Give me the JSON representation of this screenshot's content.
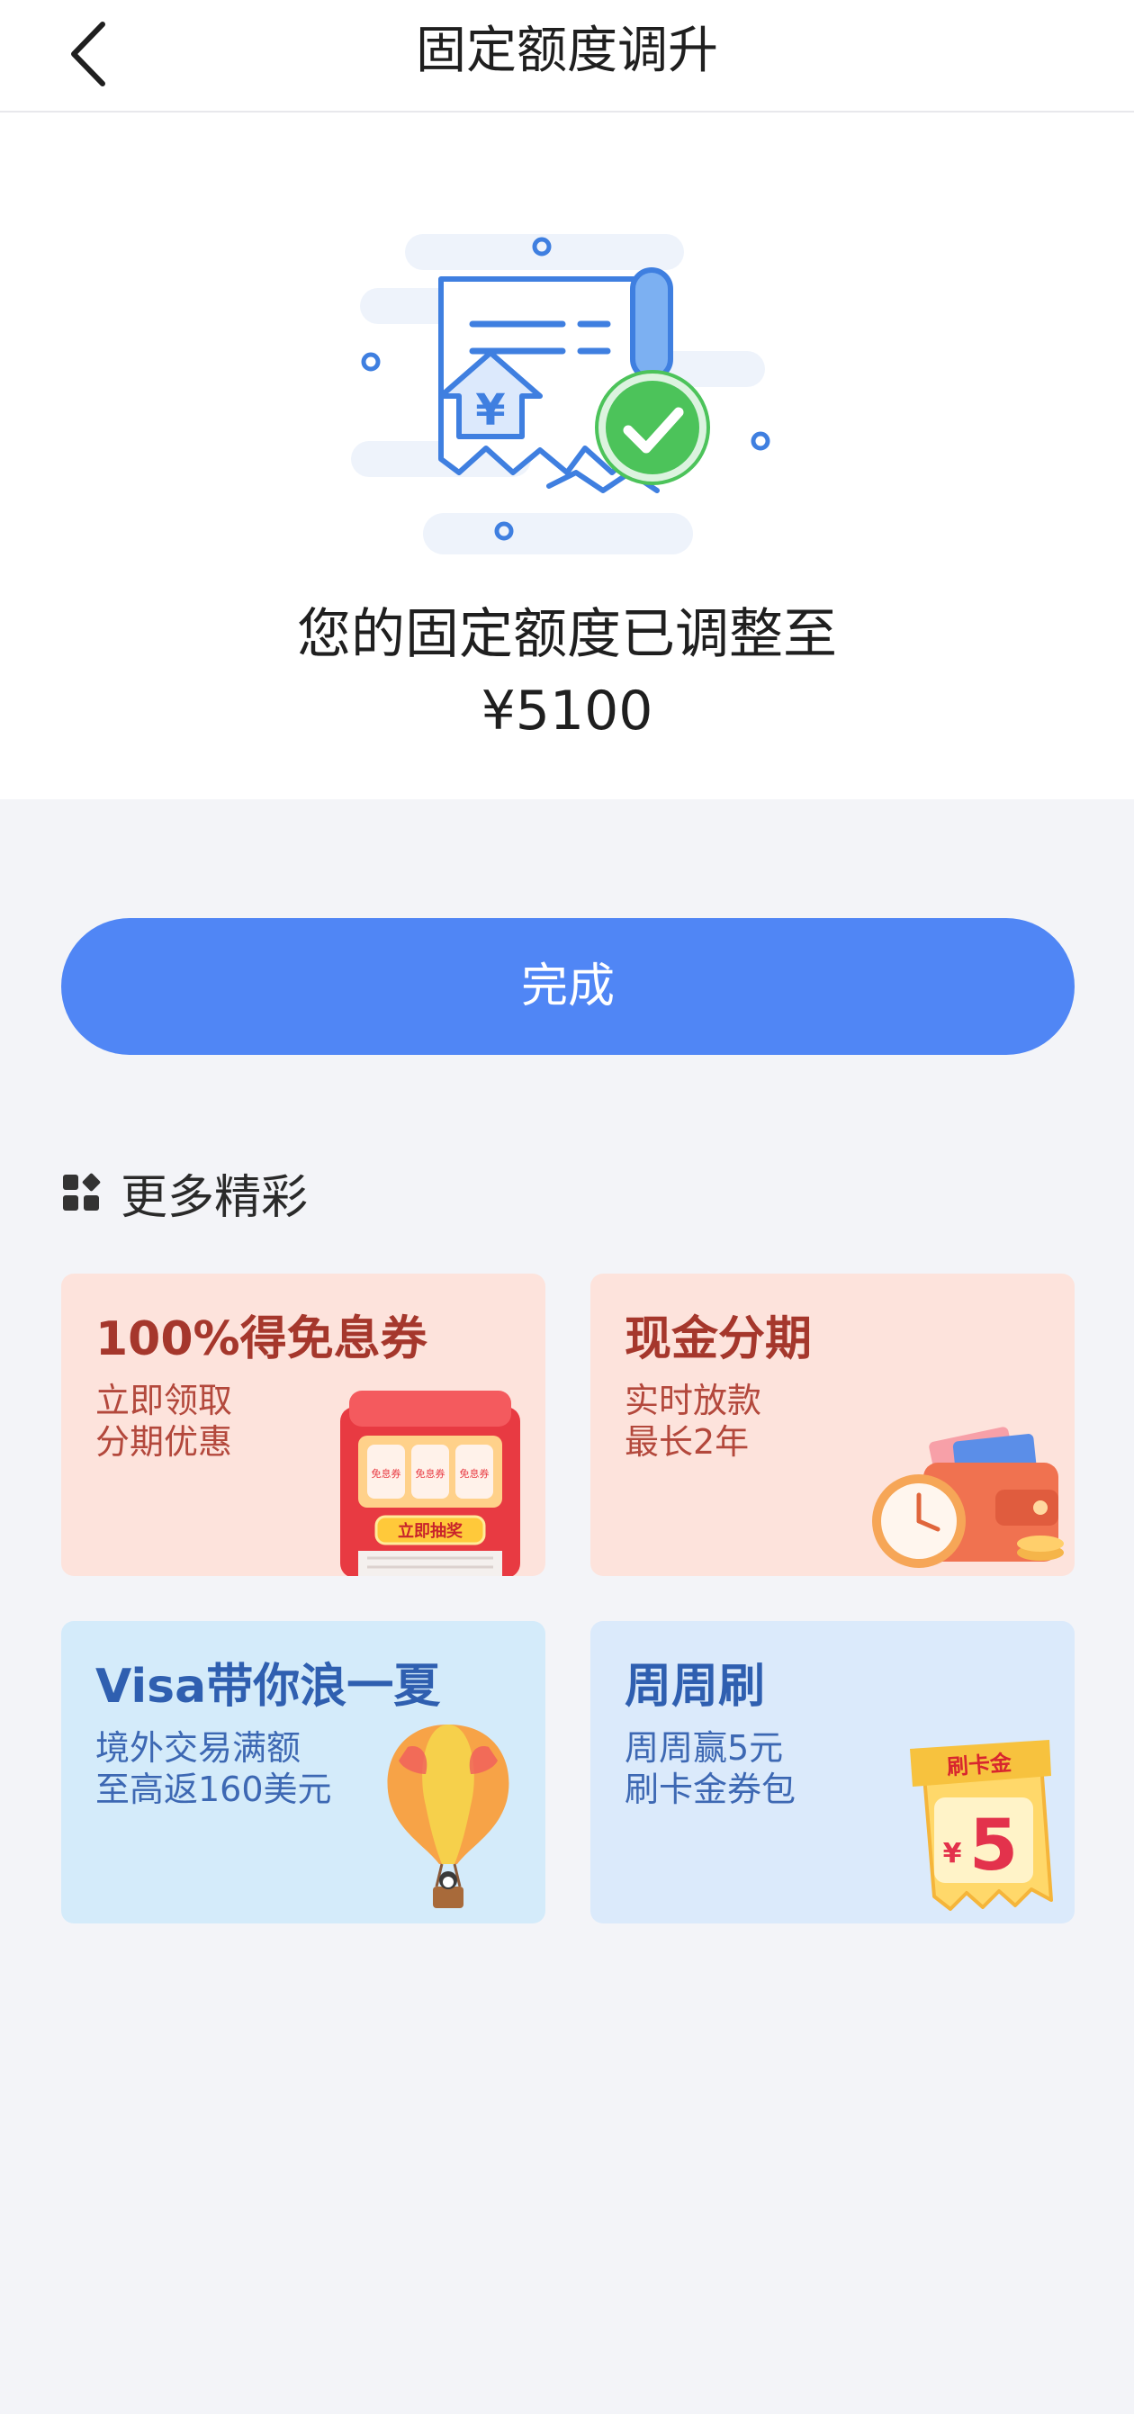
{
  "header": {
    "title": "固定额度调升",
    "back_icon": "chevron-left-icon"
  },
  "result": {
    "message": "您的固定额度已调整至",
    "amount": "¥5100",
    "illustration_badge": "¥"
  },
  "actions": {
    "done_label": "完成"
  },
  "more": {
    "title": "更多精彩",
    "icon": "grid-icon",
    "cards": [
      {
        "title": "100%得免息券",
        "sub1": "立即领取",
        "sub2": "分期优惠",
        "art_label": "立即抽奖",
        "art_slot": "免息券"
      },
      {
        "title": "现金分期",
        "sub1": "实时放款",
        "sub2": "最长2年"
      },
      {
        "title": "Visa带你浪一夏",
        "sub1": "境外交易满额",
        "sub2": "至高返160美元"
      },
      {
        "title": "周周刷",
        "sub1": "周周赢5元",
        "sub2": "刷卡金券包",
        "art_label": "刷卡金",
        "art_currency": "¥",
        "art_value": "5"
      }
    ]
  },
  "colors": {
    "accent": "#5086f5",
    "card_red_bg": "#fde3dc",
    "card_blue_bg": "#d4ebfa",
    "success_green": "#4cc35a"
  }
}
